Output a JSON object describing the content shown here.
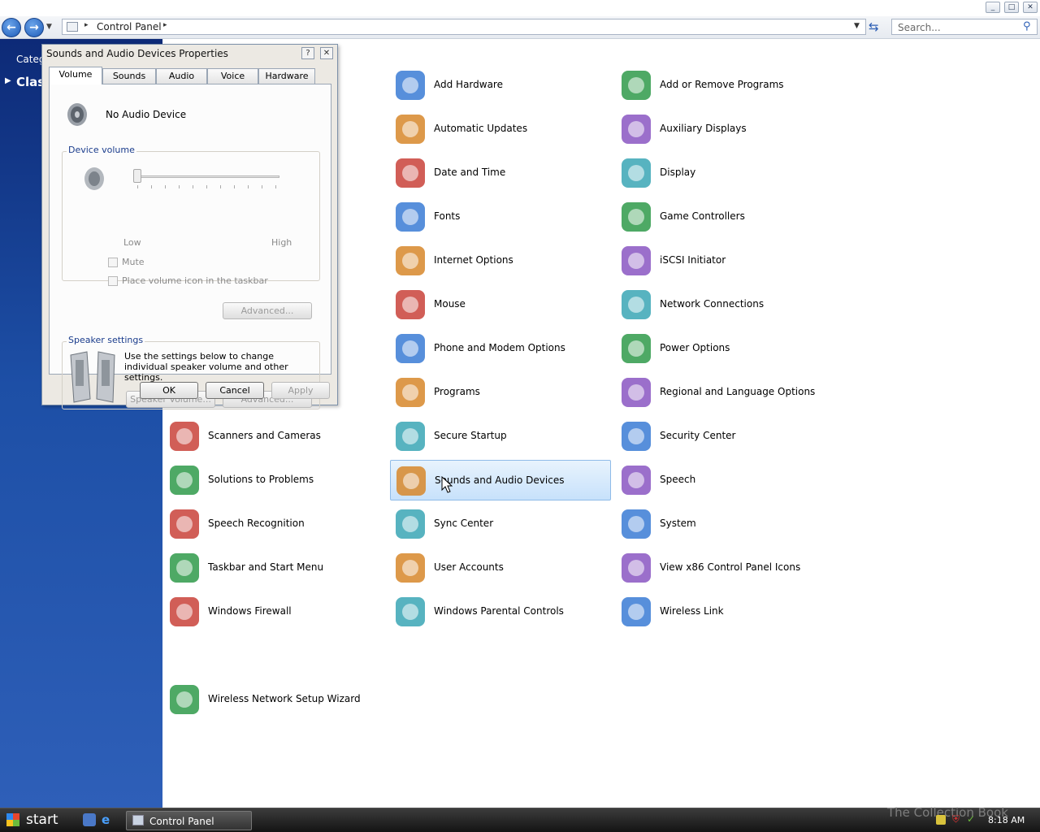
{
  "window": {
    "title": "Control Panel",
    "minimize": "_",
    "maximize": "□",
    "close": "✕"
  },
  "toolbar": {
    "back_icon": "back-arrow-icon",
    "forward_icon": "forward-arrow-icon",
    "breadcrumb": "Control Panel",
    "search_placeholder": "Search..."
  },
  "sidebar": {
    "category_label": "Categ",
    "classic_label": "Clas"
  },
  "items": [
    {
      "name": "add-hardware",
      "label": "Add Hardware",
      "icon": "hardware-icon"
    },
    {
      "name": "add-remove-programs",
      "label": "Add or Remove Programs",
      "icon": "programs-cd-icon"
    },
    {
      "name": "automatic-updates",
      "label": "Automatic Updates",
      "icon": "windows-globe-icon"
    },
    {
      "name": "auxiliary-displays",
      "label": "Auxiliary Displays",
      "icon": "auxiliary-display-icon"
    },
    {
      "name": "date-time",
      "label": "Date and Time",
      "icon": "clock-icon"
    },
    {
      "name": "display",
      "label": "Display",
      "icon": "monitor-icon"
    },
    {
      "name": "fonts",
      "label": "Fonts",
      "icon": "folder-icon"
    },
    {
      "name": "game-controllers",
      "label": "Game Controllers",
      "icon": "gamepad-icon"
    },
    {
      "name": "internet-options",
      "label": "Internet Options",
      "icon": "globe-check-icon"
    },
    {
      "name": "iscsi-initiator",
      "label": "iSCSI Initiator",
      "icon": "globe-network-icon"
    },
    {
      "name": "mouse",
      "label": "Mouse",
      "icon": "mouse-icon"
    },
    {
      "name": "network-connections",
      "label": "Network Connections",
      "icon": "globe-network-icon"
    },
    {
      "name": "phone-modem",
      "label": "Phone and Modem Options",
      "icon": "phone-icon"
    },
    {
      "name": "power-options",
      "label": "Power Options",
      "icon": "power-plug-icon"
    },
    {
      "name": "programs",
      "label": "Programs",
      "icon": "programs-icon"
    },
    {
      "name": "regional-language",
      "label": "Regional and Language Options",
      "icon": "globe-icon"
    },
    {
      "name": "scanners-cameras",
      "label": "Scanners and Cameras",
      "icon": "camera-icon"
    },
    {
      "name": "secure-startup",
      "label": "Secure Startup",
      "icon": "keys-icon"
    },
    {
      "name": "security-center",
      "label": "Security Center",
      "icon": "shield-icon"
    },
    {
      "name": "solutions-problems",
      "label": "Solutions to Problems",
      "icon": "checkmark-icon"
    },
    {
      "name": "sounds-audio",
      "label": "Sounds and Audio Devices",
      "icon": "speaker-icon"
    },
    {
      "name": "speech",
      "label": "Speech",
      "icon": "speech-bubble-icon"
    },
    {
      "name": "speech-recognition",
      "label": "Speech Recognition",
      "icon": "document-icon"
    },
    {
      "name": "sync-center",
      "label": "Sync Center",
      "icon": "sync-arrows-icon"
    },
    {
      "name": "system",
      "label": "System",
      "icon": "system-monitor-icon"
    },
    {
      "name": "taskbar-start-menu",
      "label": "Taskbar and Start Menu",
      "icon": "taskbar-icon"
    },
    {
      "name": "user-accounts",
      "label": "User Accounts",
      "icon": "users-icon"
    },
    {
      "name": "view-x86",
      "label": "View x86 Control Panel Icons",
      "icon": "x86-icon"
    },
    {
      "name": "windows-firewall",
      "label": "Windows Firewall",
      "icon": "firewall-icon"
    },
    {
      "name": "parental-controls",
      "label": "Windows Parental Controls",
      "icon": "padlock-icon"
    },
    {
      "name": "wireless-link",
      "label": "Wireless Link",
      "icon": "laptop-wireless-icon"
    },
    {
      "name": "wireless-network-wizard",
      "label": "Wireless Network Setup Wizard",
      "icon": "wireless-usb-icon"
    }
  ],
  "dialog": {
    "title": "Sounds and Audio Devices Properties",
    "help": "?",
    "close": "✕",
    "tabs": [
      "Volume",
      "Sounds",
      "Audio",
      "Voice",
      "Hardware"
    ],
    "device_name": "No Audio Device",
    "device_volume_label": "Device volume",
    "slider_low": "Low",
    "slider_high": "High",
    "slider_level": 0,
    "mute_label": "Mute",
    "place_icon_label": "Place volume icon in the taskbar",
    "advanced_label": "Advanced...",
    "speaker_settings_label": "Speaker settings",
    "speaker_text": "Use the settings below to change individual speaker volume and other settings.",
    "speaker_volume_label": "Speaker Volume...",
    "speaker_advanced_label": "Advanced...",
    "ok": "OK",
    "cancel": "Cancel",
    "apply": "Apply"
  },
  "taskbar": {
    "start": "start",
    "task_label": "Control Panel",
    "clock": "8:18 AM",
    "watermark": "The Collection Book"
  }
}
